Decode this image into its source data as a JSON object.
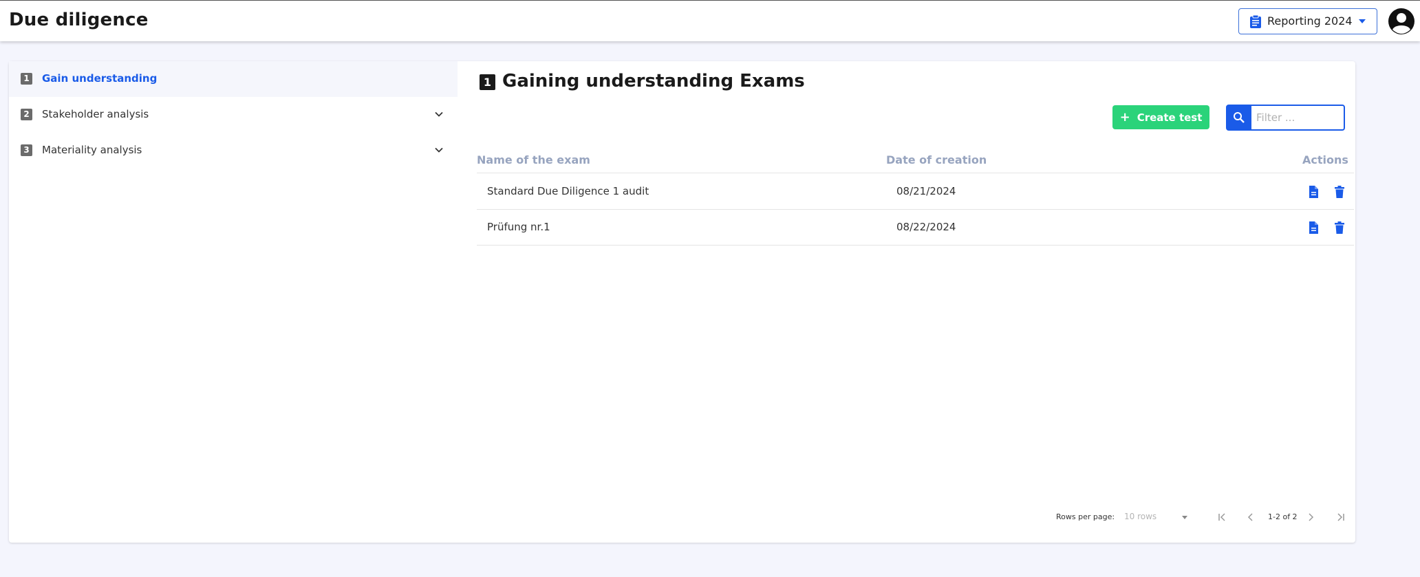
{
  "header": {
    "title": "Due diligence",
    "reporting_select": "Reporting 2024"
  },
  "sidebar": {
    "items": [
      {
        "number": "1",
        "label": "Gain understanding",
        "active": true
      },
      {
        "number": "2",
        "label": "Stakeholder analysis",
        "active": false
      },
      {
        "number": "3",
        "label": "Materiality analysis",
        "active": false
      }
    ]
  },
  "main": {
    "section_number": "1",
    "section_title": "Gaining understanding Exams",
    "create_button": "Create test",
    "filter_placeholder": "Filter ...",
    "columns": {
      "name": "Name of the exam",
      "date": "Date of creation",
      "actions": "Actions"
    },
    "rows": [
      {
        "name": "Standard Due Diligence 1 audit",
        "date": "08/21/2024"
      },
      {
        "name": "Prüfung nr.1",
        "date": "08/22/2024"
      }
    ],
    "pagination": {
      "rows_per_page_label": "Rows per page:",
      "rows_per_page_value": "10 rows",
      "range": "1-2 of 2"
    }
  },
  "colors": {
    "accent": "#1a5be8",
    "success": "#2bd37a",
    "header_text": "#97a4bf"
  }
}
